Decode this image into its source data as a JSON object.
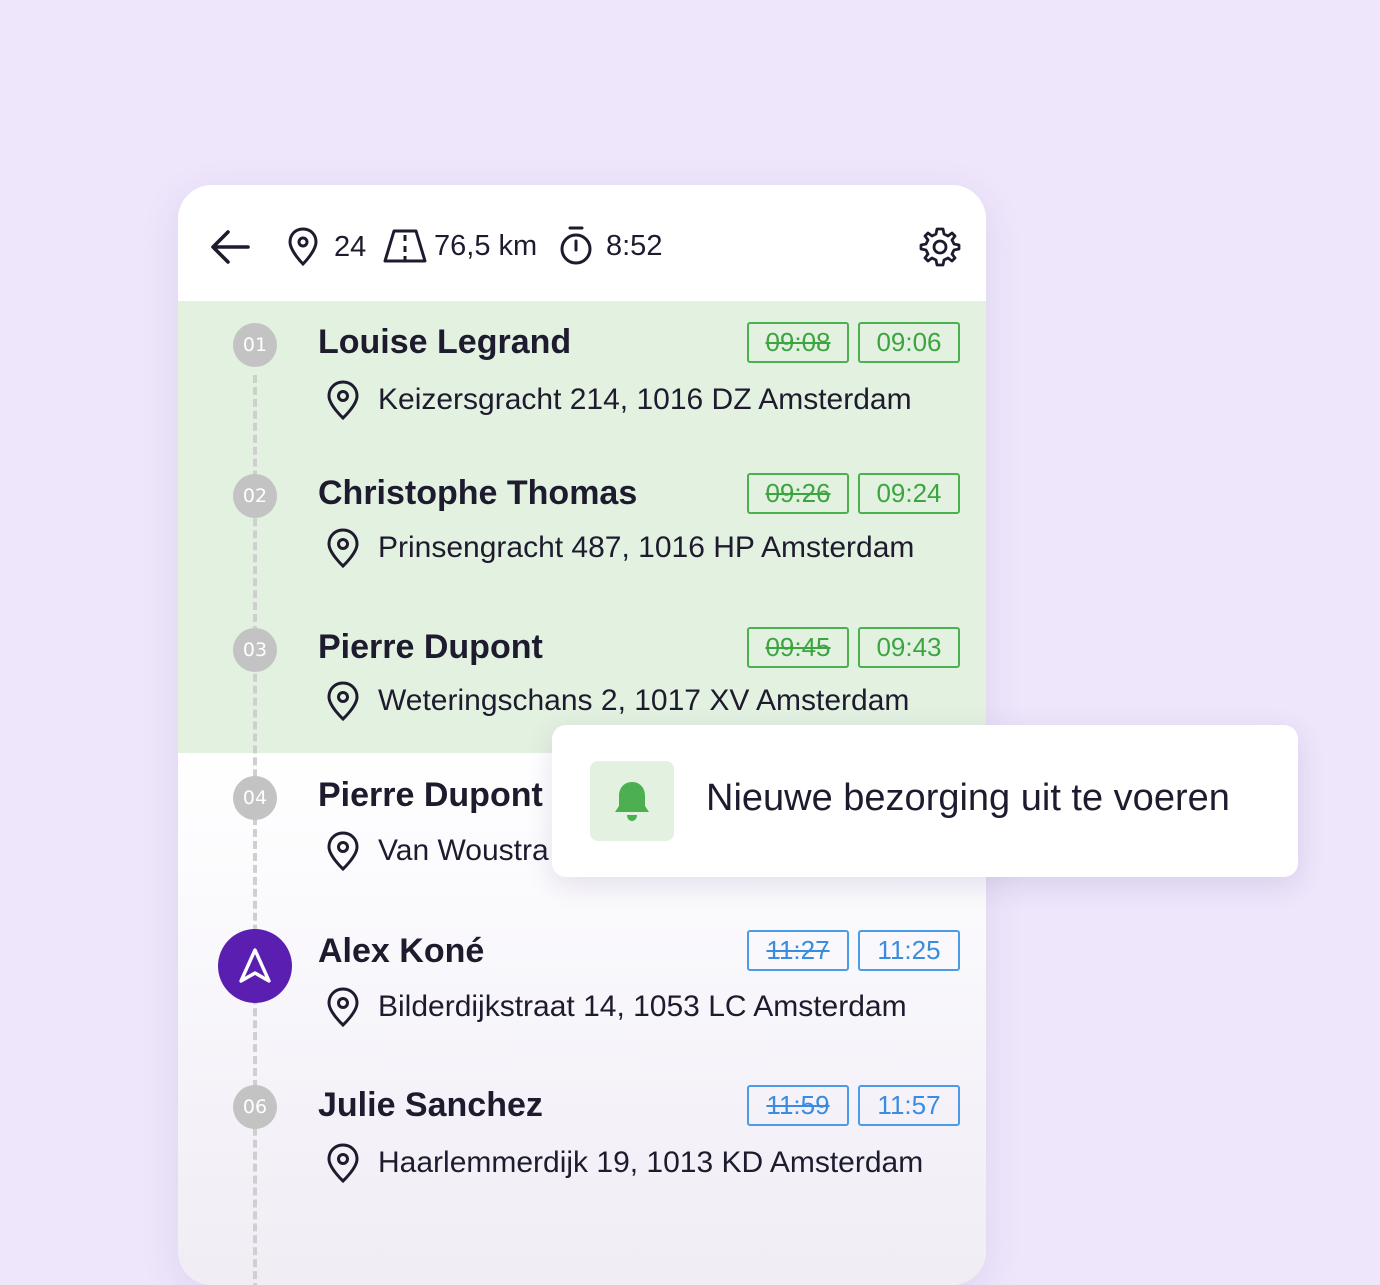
{
  "header": {
    "stops_count": "24",
    "distance": "76,5 km",
    "duration": "8:52"
  },
  "stops": [
    {
      "number": "01",
      "name": "Louise Legrand",
      "address": "Keizersgracht 214, 1016 DZ Amsterdam",
      "planned_time": "09:08",
      "new_time": "09:06",
      "status": "done"
    },
    {
      "number": "02",
      "name": "Christophe Thomas",
      "address": "Prinsengracht 487, 1016 HP Amsterdam",
      "planned_time": "09:26",
      "new_time": "09:24",
      "status": "done"
    },
    {
      "number": "03",
      "name": "Pierre Dupont",
      "address": "Weteringschans 2, 1017 XV Amsterdam",
      "planned_time": "09:45",
      "new_time": "09:43",
      "status": "done"
    },
    {
      "number": "04",
      "name": "Pierre Dupont",
      "address": "Van Woustra",
      "status": "pending"
    },
    {
      "number": "",
      "name": "Alex Koné",
      "address": "Bilderdijkstraat 14, 1053 LC Amsterdam",
      "planned_time": "11:27",
      "new_time": "11:25",
      "status": "current"
    },
    {
      "number": "06",
      "name": "Julie Sanchez",
      "address": "Haarlemmerdijk 19, 1013 KD Amsterdam",
      "planned_time": "11:59",
      "new_time": "11:57",
      "status": "upcoming"
    }
  ],
  "notification": {
    "icon": "bell-icon",
    "message": "Nieuwe bezorging uit te voeren"
  },
  "colors": {
    "background": "#EEE6FB",
    "done_row": "#E3F1E1",
    "green": "#3DA540",
    "blue": "#3A8CE0",
    "purple": "#5A1FB0"
  }
}
